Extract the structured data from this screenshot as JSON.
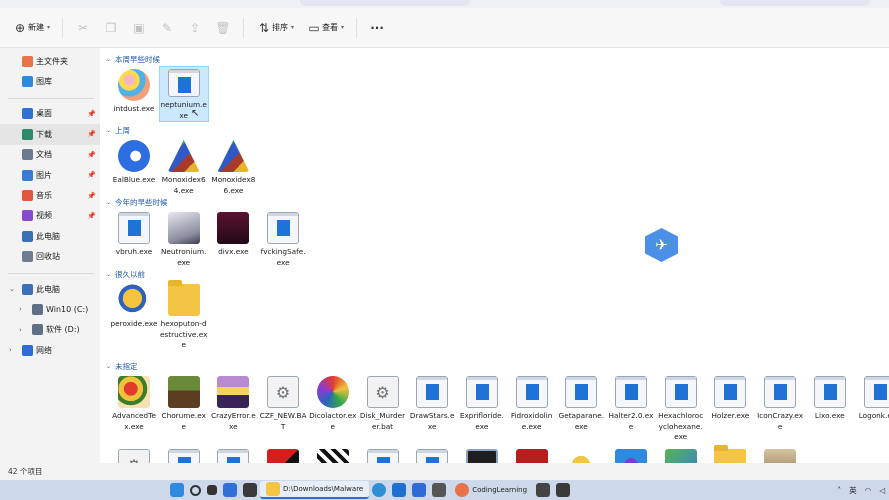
{
  "toolbar": {
    "new_label": "新建",
    "sort_label": "排序",
    "view_label": "查看"
  },
  "sidebar": {
    "items": [
      {
        "label": "主文件夹",
        "icon": "home-icon",
        "color": "#e8734a"
      },
      {
        "label": "图库",
        "icon": "gallery-icon",
        "color": "#2e8ae0"
      },
      {
        "label": "桌面",
        "icon": "desktop-icon",
        "color": "#2f6fd6",
        "pinned": true
      },
      {
        "label": "下载",
        "icon": "download-icon",
        "color": "#2e8a6a",
        "pinned": true,
        "selected": true
      },
      {
        "label": "文档",
        "icon": "document-icon",
        "color": "#6b7a90",
        "pinned": true
      },
      {
        "label": "图片",
        "icon": "pictures-icon",
        "color": "#3a7bd5",
        "pinned": true
      },
      {
        "label": "音乐",
        "icon": "music-icon",
        "color": "#e0573c",
        "pinned": true
      },
      {
        "label": "视频",
        "icon": "video-icon",
        "color": "#8a4ad0",
        "pinned": true
      },
      {
        "label": "此电脑",
        "icon": "computer-icon",
        "color": "#3b6fb6"
      },
      {
        "label": "回收站",
        "icon": "recycle-bin-icon",
        "color": "#6e7d91"
      },
      {
        "label": "此电脑",
        "icon": "computer-icon",
        "color": "#3b6fb6",
        "expanded": true
      },
      {
        "label": "Win10 (C:)",
        "icon": "drive-icon",
        "color": "#5f6f86"
      },
      {
        "label": "软件 (D:)",
        "icon": "drive-icon",
        "color": "#5f6f86"
      },
      {
        "label": "网络",
        "icon": "network-icon",
        "color": "#2e6bd6"
      }
    ]
  },
  "groups": [
    {
      "title": "本周早些时候",
      "files": [
        {
          "name": "intdust.exe",
          "icon": "ic-palette"
        },
        {
          "name": "neptunium.exe",
          "icon": "ic-exe",
          "selected": true
        }
      ]
    },
    {
      "title": "上周",
      "files": [
        {
          "name": "EalBlue.exe",
          "icon": "ic-edge"
        },
        {
          "name": "Monoxidex64.exe",
          "icon": "ic-mono"
        },
        {
          "name": "Monoxidex86.exe",
          "icon": "ic-mono"
        }
      ]
    },
    {
      "title": "今年的早些时候",
      "files": [
        {
          "name": "vbruh.exe",
          "icon": "ic-exe"
        },
        {
          "name": "Neutronium.exe",
          "icon": "ic-neutro"
        },
        {
          "name": "divx.exe",
          "icon": "ic-divx"
        },
        {
          "name": "fvckingSafe.exe",
          "icon": "ic-exe"
        }
      ]
    },
    {
      "title": "很久以前",
      "files": [
        {
          "name": "peroxide.exe",
          "icon": "ic-perox"
        },
        {
          "name": "hexoputon-destructive.exe",
          "icon": "ic-folder"
        }
      ]
    },
    {
      "title": "未指定",
      "files": [
        {
          "name": "AdvancedTex.exe",
          "icon": "ic-adv"
        },
        {
          "name": "Chorume.exe",
          "icon": "ic-chor"
        },
        {
          "name": "CrazyError.exe",
          "icon": "ic-crazy"
        },
        {
          "name": "CZF_NEW.BAT",
          "icon": "ic-bat"
        },
        {
          "name": "Dicolactor.exe",
          "icon": "ic-dico"
        },
        {
          "name": "Disk_Murderer.bat",
          "icon": "ic-bat"
        },
        {
          "name": "DrawStars.exe",
          "icon": "ic-exe"
        },
        {
          "name": "Exprifloride.exe",
          "icon": "ic-exe"
        },
        {
          "name": "Fidroxidoline.exe",
          "icon": "ic-exe"
        },
        {
          "name": "Getaparane.exe",
          "icon": "ic-exe"
        },
        {
          "name": "Halter2.0.exe",
          "icon": "ic-exe"
        },
        {
          "name": "Hexachlorocyclohexane.exe",
          "icon": "ic-exe"
        },
        {
          "name": "Holzer.exe",
          "icon": "ic-exe"
        },
        {
          "name": "IconCrazy.exe",
          "icon": "ic-exe"
        },
        {
          "name": "Lixo.exe",
          "icon": "ic-exe"
        },
        {
          "name": "Logonk.exe",
          "icon": "ic-exe"
        },
        {
          "name": "",
          "icon": "ic-bat"
        },
        {
          "name": "",
          "icon": "ic-exe"
        },
        {
          "name": "",
          "icon": "ic-exe"
        },
        {
          "name": "",
          "icon": "ic-red"
        },
        {
          "name": "",
          "icon": "ic-bw"
        },
        {
          "name": "",
          "icon": "ic-exe"
        },
        {
          "name": "",
          "icon": "ic-exe"
        },
        {
          "name": "",
          "icon": "ic-robot"
        },
        {
          "name": "",
          "icon": "ic-pagoda"
        },
        {
          "name": "",
          "icon": "ic-sun"
        },
        {
          "name": "",
          "icon": "ic-blue"
        },
        {
          "name": "",
          "icon": "ic-leaf"
        },
        {
          "name": "",
          "icon": "ic-folder"
        },
        {
          "name": "",
          "icon": "ic-tan"
        }
      ]
    }
  ],
  "status": {
    "item_count": "42 个项目"
  },
  "taskbar": {
    "apps": [
      {
        "label": "D:\\Downloads\\Malware",
        "active": true
      },
      {
        "label": "CodingLearning",
        "active": false
      }
    ],
    "tray_lang": "英"
  }
}
